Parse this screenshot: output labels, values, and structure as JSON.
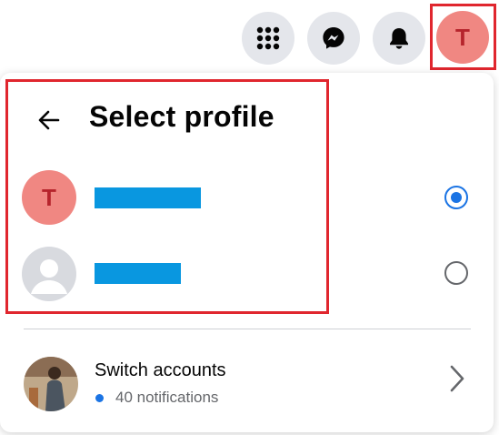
{
  "topbar": {
    "buttons": [
      {
        "icon": "menu-grid-icon"
      },
      {
        "icon": "messenger-icon"
      },
      {
        "icon": "bell-icon"
      }
    ],
    "account_avatar_initial": "T"
  },
  "panel": {
    "title": "Select profile",
    "back_icon": "back-arrow-icon",
    "profiles": [
      {
        "avatar_initial": "T",
        "selected": true
      },
      {
        "avatar_icon": "default-avatar-icon",
        "selected": false
      }
    ],
    "switch_accounts": {
      "label": "Switch accounts",
      "notifications": "40 notifications",
      "chevron_icon": "chevron-right-icon"
    }
  },
  "colors": {
    "accent": "#1b74e4",
    "avatar_bg": "#f08782",
    "avatar_text": "#b6242c",
    "highlight": "#e0262e",
    "redaction": "#0997e0"
  }
}
